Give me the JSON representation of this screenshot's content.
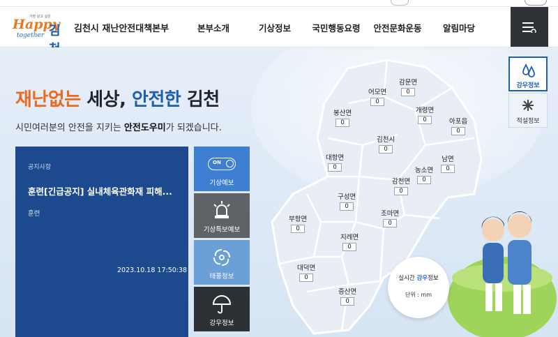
{
  "header": {
    "logo_small": "가장 살고 싶은 Happy together 김천",
    "logo_happy": "Happy",
    "logo_together": "together",
    "logo_city": "김천",
    "site_title": "김천시 재난안전대책본부",
    "nav": [
      "본부소개",
      "기상정보",
      "국민행동요령",
      "안전문화운동",
      "알림마당"
    ],
    "menu_icon": "menu-icon"
  },
  "hero": {
    "headline_part1": "재난없는",
    "headline_part2": " 세상,",
    "headline_part3": " 안전한",
    "headline_part4": " 김천",
    "sub_pre": "시민여러분의 안전을 지키는 ",
    "sub_bold": "안전도우미",
    "sub_post": "가 되겠습니다."
  },
  "notice": {
    "category": "공지사항",
    "title": "훈련[긴급공지] 실내체육관화재 피해...",
    "tag": "훈련",
    "date": "2023.10.18 17:50:38"
  },
  "quick_menu": [
    {
      "label": "기상예보",
      "icon": "on-toggle-icon",
      "on_text": "ON"
    },
    {
      "label": "기상특보예보",
      "icon": "siren-icon"
    },
    {
      "label": "태풍정보",
      "icon": "typhoon-icon"
    },
    {
      "label": "강우정보",
      "icon": "umbrella-icon"
    }
  ],
  "map": {
    "regions": [
      {
        "name": "감문면",
        "value": "0"
      },
      {
        "name": "어모면",
        "value": "0"
      },
      {
        "name": "봉산면",
        "value": "0"
      },
      {
        "name": "개령면",
        "value": "0"
      },
      {
        "name": "아포읍",
        "value": "0"
      },
      {
        "name": "김천시",
        "value": "0"
      },
      {
        "name": "대항면",
        "value": "0"
      },
      {
        "name": "남면",
        "value": "0"
      },
      {
        "name": "농소면",
        "value": "0"
      },
      {
        "name": "감천면",
        "value": "0"
      },
      {
        "name": "구성면",
        "value": "0"
      },
      {
        "name": "조마면",
        "value": "0"
      },
      {
        "name": "부항면",
        "value": "0"
      },
      {
        "name": "지례면",
        "value": "0"
      },
      {
        "name": "대덕면",
        "value": "0"
      },
      {
        "name": "증산면",
        "value": "0"
      }
    ],
    "realtime_prefix": "실시간",
    "realtime_highlight": "강우",
    "realtime_suffix": "정보",
    "unit_label": "단위 : mm"
  },
  "side_tabs": [
    {
      "label": "강우정보",
      "icon": "raindrops-icon",
      "active": true
    },
    {
      "label": "적설정보",
      "icon": "snowflake-icon",
      "active": false
    }
  ],
  "colors": {
    "brand_blue": "#1f5fb0",
    "brand_orange": "#ea6b1e",
    "notice_bg": "#1d4a8e"
  }
}
